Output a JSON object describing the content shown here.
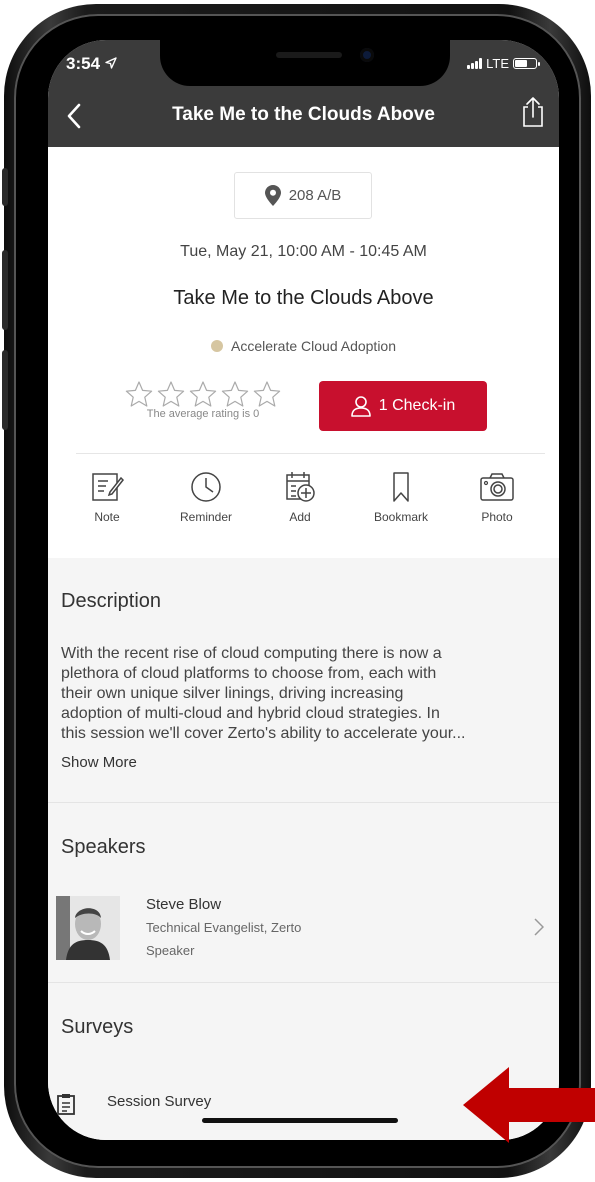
{
  "status_bar": {
    "time": "3:54",
    "network": "LTE"
  },
  "nav": {
    "title": "Take Me to the Clouds Above"
  },
  "session": {
    "location": "208 A/B",
    "datetime": "Tue, May 21, 10:00 AM - 10:45 AM",
    "title": "Take Me to the Clouds Above",
    "track": "Accelerate Cloud Adoption",
    "track_color": "#d6c6a1",
    "rating_text": "The average rating is 0",
    "rating_value": 0,
    "rating_max": 5,
    "checkin_label": "1 Check-in"
  },
  "actions": [
    {
      "label": "Note",
      "icon": "note-icon"
    },
    {
      "label": "Reminder",
      "icon": "clock-icon"
    },
    {
      "label": "Add",
      "icon": "calendar-add-icon"
    },
    {
      "label": "Bookmark",
      "icon": "bookmark-icon"
    },
    {
      "label": "Photo",
      "icon": "camera-icon"
    }
  ],
  "description": {
    "heading": "Description",
    "lines": [
      "With the recent rise of cloud computing there is now a",
      "plethora of cloud platforms to choose from, each with",
      "their own unique silver linings, driving increasing",
      "adoption of multi-cloud and hybrid cloud strategies. In",
      "this session we'll cover Zerto's ability to accelerate your..."
    ],
    "show_more": "Show More"
  },
  "speakers": {
    "heading": "Speakers",
    "items": [
      {
        "name": "Steve Blow",
        "role": "Technical Evangelist, Zerto",
        "type": "Speaker"
      }
    ]
  },
  "surveys": {
    "heading": "Surveys",
    "items": [
      {
        "label": "Session Survey"
      }
    ]
  },
  "colors": {
    "accent": "#c8102e",
    "appbar": "#3b3b3b",
    "annotation_arrow": "#c00000"
  }
}
